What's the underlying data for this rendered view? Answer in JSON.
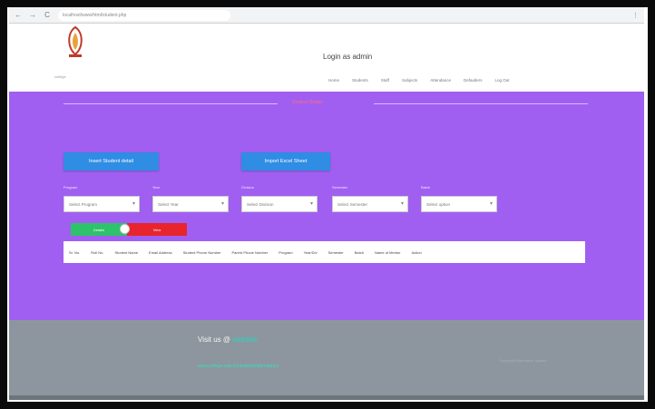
{
  "browser": {
    "back": "←",
    "forward": "→",
    "reload": "C",
    "url": "localhost/www/html/student.php",
    "menu": "⋮"
  },
  "header": {
    "logo_caption": "college",
    "login_title": "Login as admin",
    "nav": [
      "Home",
      "Students",
      "Staff",
      "Subjects",
      "Attendance",
      "Defaulters",
      "Log Out"
    ]
  },
  "panel": {
    "section_title": "Student Details",
    "buttons": {
      "insert_student": "Insert Student detail",
      "import_sheet": "Import Excel Sheet"
    },
    "filters": [
      {
        "label": "Program",
        "value": "Select Program"
      },
      {
        "label": "Year",
        "value": "Select Year"
      },
      {
        "label": "Division",
        "value": "Select Division"
      },
      {
        "label": "Semester",
        "value": "Select Semester"
      },
      {
        "label": "Batch",
        "value": "Select option"
      }
    ],
    "toggle": {
      "on": "Details",
      "off": "View"
    },
    "table_headers": [
      "Sr. No.",
      "Roll No.",
      "Student Name",
      "Email Address",
      "Student Phone Number",
      "Parent Phone Number",
      "Program",
      "Year/Div",
      "Semester",
      "Batch",
      "Name of Mentor",
      "Action"
    ]
  },
  "footer": {
    "visit_label": "Visit us @",
    "visit_link": "website",
    "link_text": "www.college.edu.in/students/attendance",
    "right_text": "Copyright Attendance System"
  },
  "colors": {
    "panel_bg": "#a05ff0",
    "button_blue": "#2f8de4",
    "toggle_green": "#2ec26a",
    "toggle_red": "#e8242d",
    "footer_bg": "#8d969e"
  }
}
